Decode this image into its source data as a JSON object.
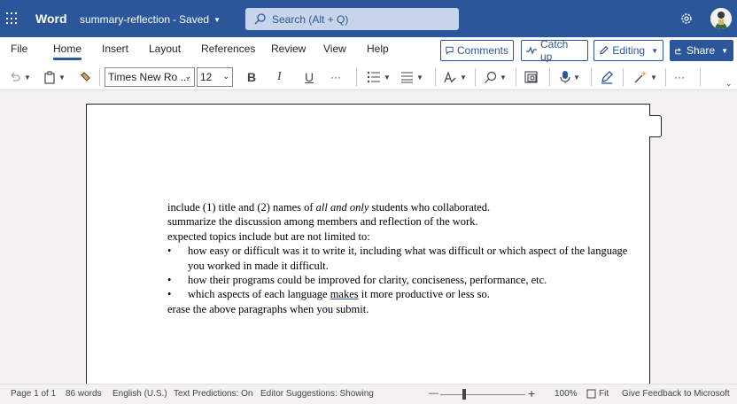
{
  "header": {
    "app_name": "Word",
    "doc_title": "summary-reflection",
    "save_state": "Saved",
    "search_placeholder": "Search (Alt + Q)"
  },
  "ribbon": {
    "tabs": [
      "File",
      "Home",
      "Insert",
      "Layout",
      "References",
      "Review",
      "View",
      "Help"
    ],
    "active_tab": "Home",
    "comments_label": "Comments",
    "catchup_label": "Catch up",
    "editing_label": "Editing",
    "share_label": "Share"
  },
  "toolbar": {
    "font_name": "Times New Ro ...",
    "font_size": "12",
    "bold": "B",
    "italic": "I",
    "underline": "U",
    "more": "···"
  },
  "document": {
    "line1_a": "include (1) title and (2) names of ",
    "line1_em": "all and only",
    "line1_b": " students who collaborated.",
    "line2": "summarize the discussion among members and reflection of the work.",
    "line3": "expected topics include but are not limited to:",
    "bullet1": "how easy or difficult was it to write it, including what was difficult or which aspect of the language you worked in made it difficult.",
    "bullet2": "how their programs could be improved for clarity, conciseness, performance, etc.",
    "bullet3_a": "which aspects of each language ",
    "bullet3_u": "makes",
    "bullet3_b": " it more productive or less so.",
    "line4": "erase the above paragraphs when you submit."
  },
  "status": {
    "page": "Page 1 of 1",
    "words": "86 words",
    "language": "English (U.S.)",
    "text_predictions": "Text Predictions: On",
    "editor_suggestions": "Editor Suggestions: Showing",
    "zoom_minus": "—",
    "zoom_plus": "+",
    "zoom_level": "100%",
    "fit": "Fit",
    "feedback": "Give Feedback to Microsoft"
  },
  "colors": {
    "brand": "#2b579a",
    "canvas": "#f3f2f1"
  }
}
